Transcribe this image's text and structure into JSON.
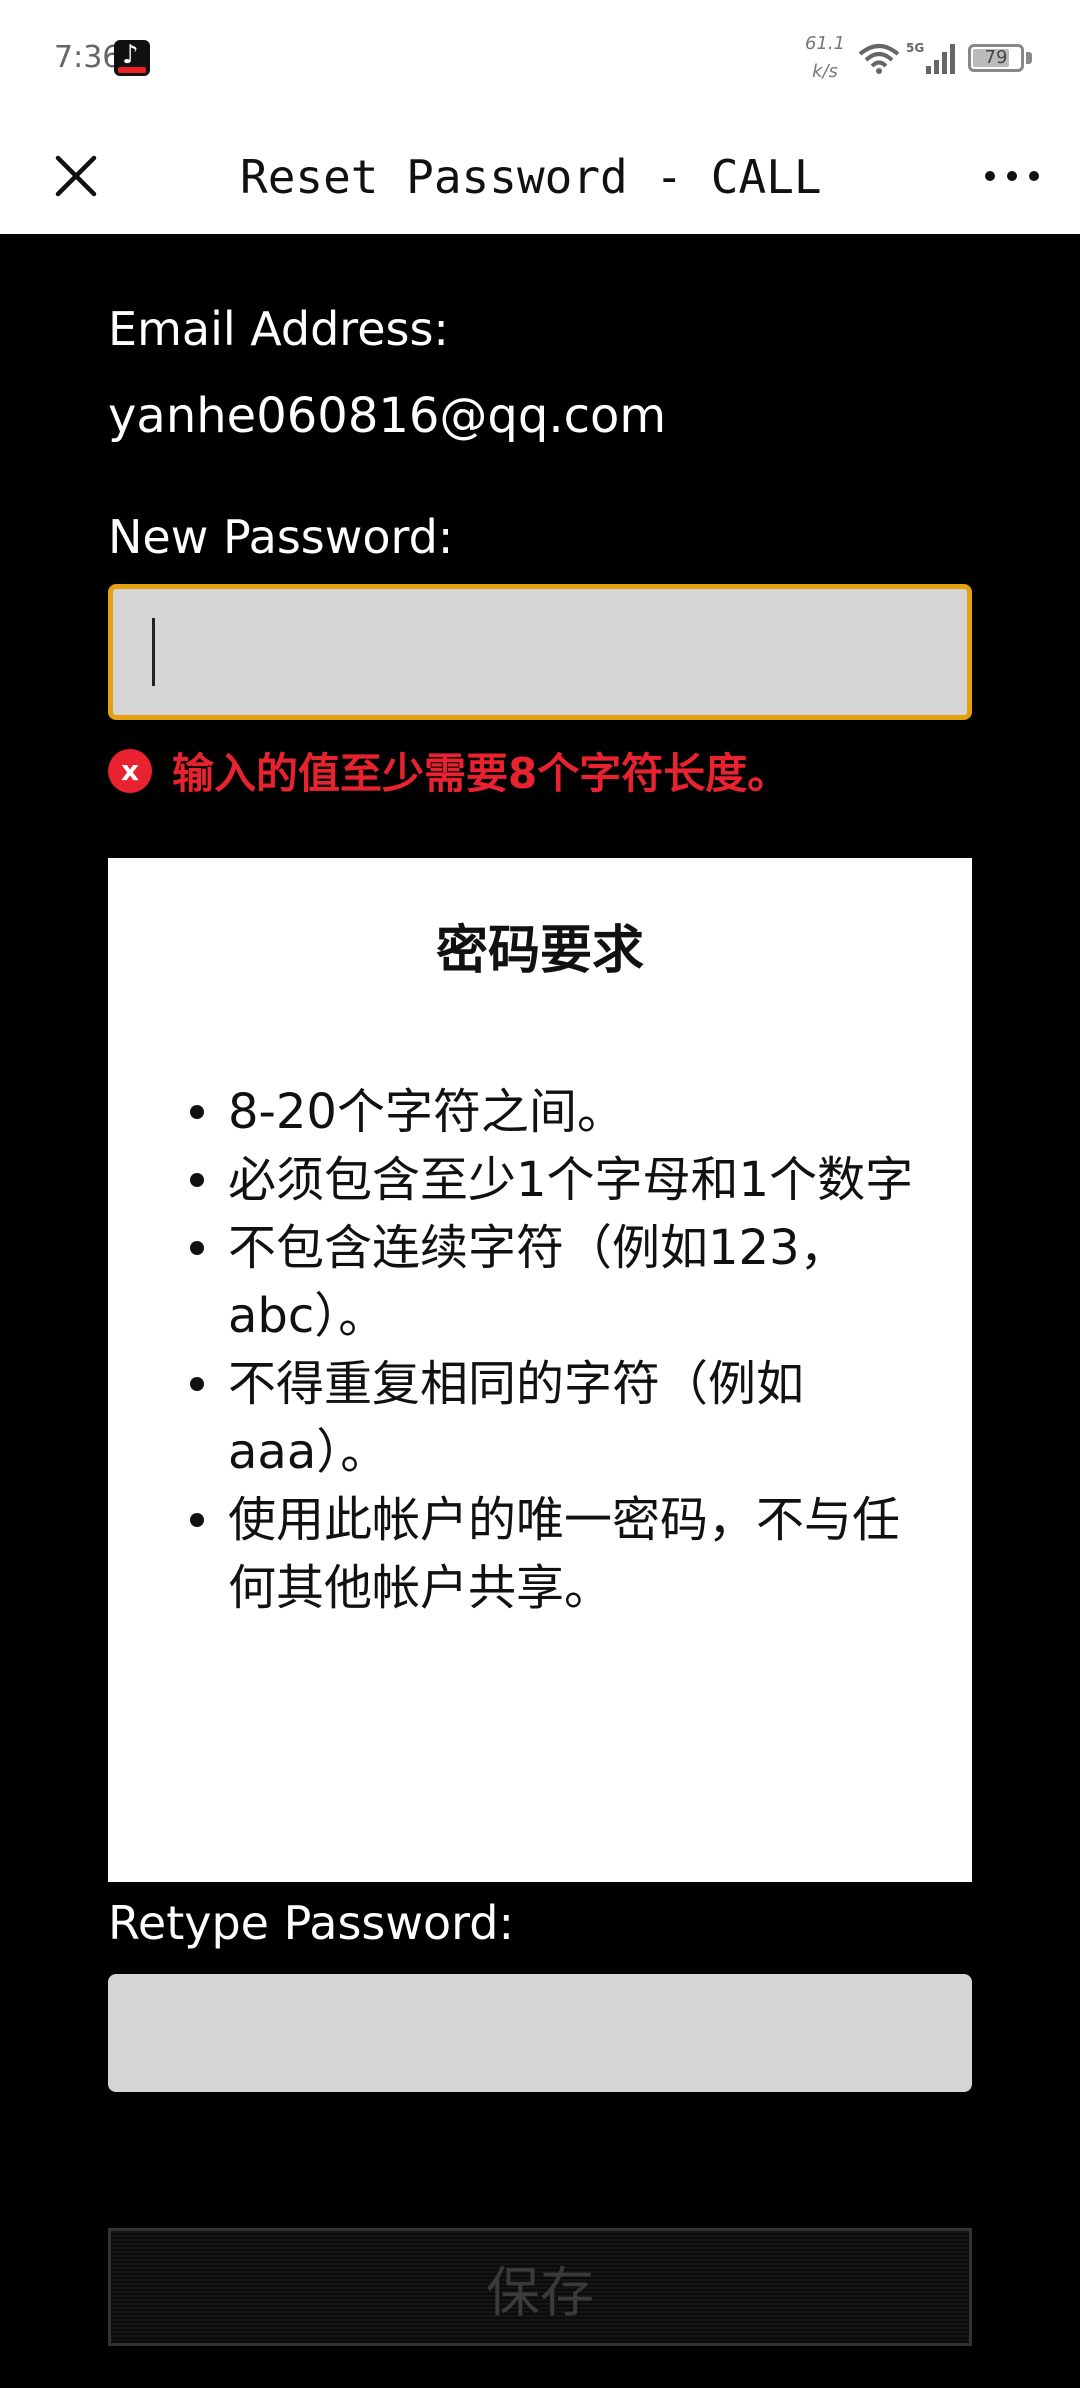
{
  "status_bar": {
    "time": "7:36",
    "net_speed_value": "61.1",
    "net_speed_unit": "k/s",
    "network_type": "5G",
    "battery": "79",
    "battery_level": 0.79
  },
  "app_bar": {
    "title": "Reset Password - CALL …",
    "close_icon": "close-icon",
    "more_icon": "more-horizontal-icon"
  },
  "form": {
    "email_label": "Email Address:",
    "email_value": "yanhe060816@qq.com",
    "new_password_label": "New Password:",
    "new_password_value": "",
    "error_icon_text": "x",
    "error_message": "输入的值至少需要8个字符长度。",
    "retype_password_label": "Retype Password:",
    "retype_password_value": "",
    "save_label": "保存"
  },
  "requirements": {
    "title": "密码要求",
    "items": [
      "8-20个字符之间。",
      "必须包含至少1个字母和1个数字",
      "不包含连续字符（例如123，abc）。",
      "不得重复相同的字符（例如aaa）。",
      "使用此帐户的唯一密码，不与任何其他帐户共享。"
    ]
  },
  "colors": {
    "focus_border": "#e4a00f",
    "error": "#e8232f",
    "input_bg": "#d5d5d5",
    "page_bg": "#000000"
  }
}
